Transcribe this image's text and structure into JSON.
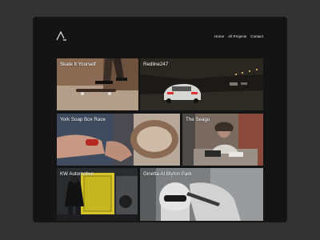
{
  "nav": {
    "items": [
      "Home",
      "All Projects",
      "Contact"
    ]
  },
  "projects": [
    {
      "title": "Skate It Yourself"
    },
    {
      "title": "Redline247"
    },
    {
      "title": "York Soap Box Race"
    },
    {
      "title": "The Seagu"
    },
    {
      "title": "KW Automotive"
    },
    {
      "title": "Ginetta At Blyton Park"
    }
  ],
  "colors": {
    "page_background": "#333333",
    "window_background": "#141414",
    "text": "#ffffff"
  },
  "icons": {
    "logo": "triangle-logo-icon"
  }
}
